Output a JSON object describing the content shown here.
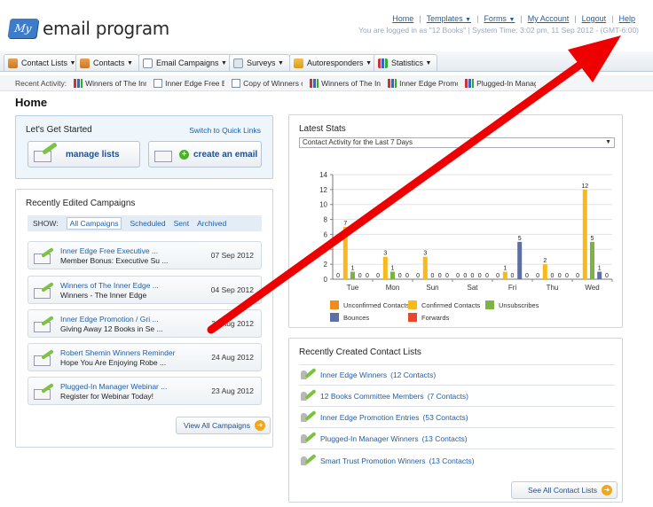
{
  "app": {
    "logo_badge": "My",
    "logo_text": "email program"
  },
  "top_links": {
    "home": "Home",
    "templates": "Templates",
    "forms": "Forms",
    "my_account": "My Account",
    "logout": "Logout",
    "help": "Help",
    "login_info": "You are logged in as \"12 Books\" | System Time: 3:02 pm, 11 Sep 2012 - (GMT-6:00)"
  },
  "nav": {
    "tabs": [
      {
        "label": "Contact Lists",
        "icon": "contacts-icon"
      },
      {
        "label": "Contacts",
        "icon": "contacts-icon"
      },
      {
        "label": "Email Campaigns",
        "icon": "envelope-icon"
      },
      {
        "label": "Surveys",
        "icon": "survey-icon"
      },
      {
        "label": "Autoresponders",
        "icon": "autoresponder-icon"
      },
      {
        "label": "Statistics",
        "icon": "bar-chart-icon"
      }
    ]
  },
  "recent": {
    "label": "Recent Activity:",
    "items": [
      "Winners of The Inner Edge",
      "Inner Edge Free Executive",
      "Copy of Winners of The",
      "Winners of The Inner Edge",
      "Inner Edge Promotion",
      "Plugged-In Manager"
    ]
  },
  "page_title": "Home",
  "getting_started": {
    "title": "Let's Get Started",
    "switch_link": "Switch to Quick Links",
    "manage_lists": "manage lists",
    "create_email": "create an email"
  },
  "recent_campaigns": {
    "title": "Recently Edited Campaigns",
    "show_label": "SHOW:",
    "filters": [
      "All Campaigns",
      "Scheduled",
      "Sent",
      "Archived"
    ],
    "items": [
      {
        "name": "Inner Edge Free Executive ...",
        "subject": "Member Bonus: Executive Su ...",
        "date": "07 Sep 2012"
      },
      {
        "name": "Winners of The Inner Edge ...",
        "subject": "Winners - The Inner Edge",
        "date": "04 Sep 2012"
      },
      {
        "name": "Inner Edge Promotion / Gri ...",
        "subject": "Giving Away 12 Books in Se ...",
        "date": "31 Aug 2012"
      },
      {
        "name": "Robert Shemin Winners Reminder",
        "subject": "Hope You Are Enjoying Robe ...",
        "date": "24 Aug 2012"
      },
      {
        "name": "Plugged-In Manager Webinar ...",
        "subject": "Register for Webinar Today!",
        "date": "23 Aug 2012"
      }
    ],
    "view_all": "View All Campaigns"
  },
  "latest_stats": {
    "title": "Latest Stats",
    "selected_option": "Contact Activity for the Last 7 Days"
  },
  "chart_data": {
    "type": "bar",
    "categories": [
      "Tue",
      "Mon",
      "Sun",
      "Sat",
      "Fri",
      "Thu",
      "Wed"
    ],
    "ylim": [
      0,
      14
    ],
    "yticks": [
      0,
      2,
      4,
      6,
      8,
      10,
      12,
      14
    ],
    "series": [
      {
        "name": "Unconfirmed Contacts",
        "color": "#f28a1e",
        "values": [
          0,
          0,
          0,
          0,
          0,
          0,
          0
        ]
      },
      {
        "name": "Confirmed Contacts",
        "color": "#f7b91c",
        "values": [
          7,
          3,
          3,
          0,
          1,
          2,
          12
        ]
      },
      {
        "name": "Unsubscribes",
        "color": "#7cb342",
        "values": [
          1,
          1,
          0,
          0,
          0,
          0,
          5
        ]
      },
      {
        "name": "Bounces",
        "color": "#5b6fa8",
        "values": [
          0,
          0,
          0,
          0,
          5,
          0,
          1
        ]
      },
      {
        "name": "Forwards",
        "color": "#e8472b",
        "values": [
          0,
          0,
          0,
          0,
          0,
          0,
          0
        ]
      }
    ]
  },
  "recent_contacts": {
    "title": "Recently Created Contact Lists",
    "items": [
      {
        "name": "Inner Edge Winners",
        "count": "(12 Contacts)"
      },
      {
        "name": "12 Books Committee Members",
        "count": "(7 Contacts)"
      },
      {
        "name": "Inner Edge Promotion Entries",
        "count": "(53 Contacts)"
      },
      {
        "name": "Plugged-In Manager Winners",
        "count": "(13 Contacts)"
      },
      {
        "name": "Smart Trust Promotion Winners",
        "count": "(13 Contacts)"
      }
    ],
    "see_all": "See All Contact Lists"
  }
}
